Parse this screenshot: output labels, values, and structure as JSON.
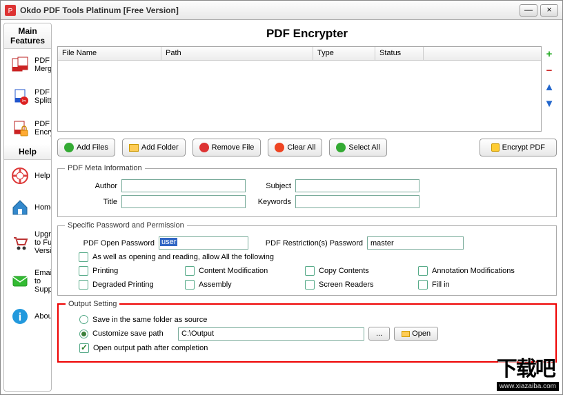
{
  "window": {
    "title": "Okdo PDF Tools Platinum [Free Version]"
  },
  "sidebar": {
    "header_main": "Main Features",
    "header_help": "Help",
    "items_main": [
      {
        "label": "PDF Merger"
      },
      {
        "label": "PDF Splitter"
      },
      {
        "label": "PDF Encrypter"
      }
    ],
    "items_help": [
      {
        "label": "Help"
      },
      {
        "label": "Home"
      },
      {
        "label": "Upgrade to Full Version"
      },
      {
        "label": "Email to Support"
      },
      {
        "label": "About"
      }
    ]
  },
  "main": {
    "title": "PDF Encrypter",
    "columns": [
      "File Name",
      "Path",
      "Type",
      "Status"
    ],
    "toolbar": {
      "add_files": "Add Files",
      "add_folder": "Add Folder",
      "remove_file": "Remove File",
      "clear_all": "Clear All",
      "select_all": "Select All",
      "encrypt": "Encrypt PDF"
    }
  },
  "meta": {
    "legend": "PDF Meta Information",
    "author_lbl": "Author",
    "author_val": "",
    "title_lbl": "Title",
    "title_val": "",
    "subject_lbl": "Subject",
    "subject_val": "",
    "keywords_lbl": "Keywords",
    "keywords_val": ""
  },
  "perm": {
    "legend": "Specific Password and Permission",
    "open_lbl": "PDF Open Password",
    "open_val": "user",
    "restrict_lbl": "PDF Restriction(s) Password",
    "restrict_val": "master",
    "allow_all": "As well as opening and reading, allow All the following",
    "printing": "Printing",
    "content_mod": "Content Modification",
    "copy": "Copy Contents",
    "annot": "Annotation Modifications",
    "degraded": "Degraded Printing",
    "assembly": "Assembly",
    "screen": "Screen Readers",
    "fillin": "Fill in"
  },
  "output": {
    "legend": "Output Setting",
    "same_folder": "Save in the same folder as source",
    "custom_path_lbl": "Customize save path",
    "custom_path_val": "C:\\Output",
    "browse": "...",
    "open_btn": "Open",
    "open_after": "Open output path after completion"
  },
  "watermark": {
    "text": "下载吧",
    "url": "www.xiazaiba.com"
  }
}
